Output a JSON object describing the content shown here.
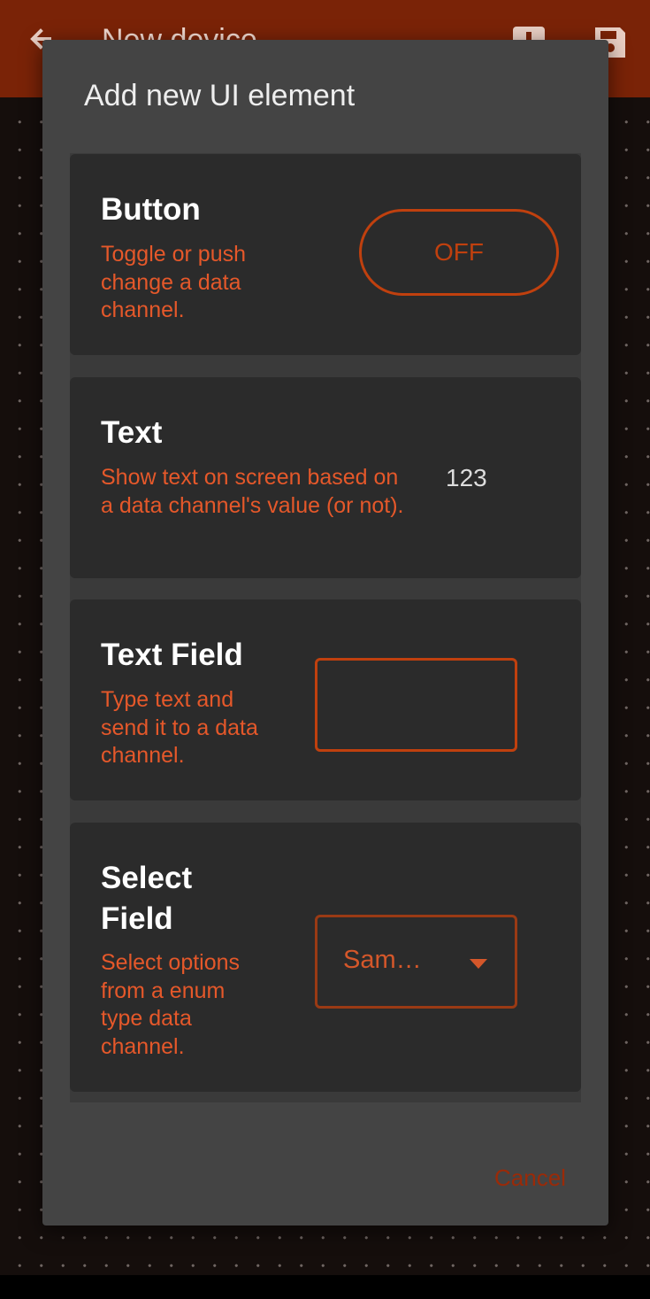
{
  "appbar": {
    "title": "New device",
    "back_icon": "arrow-back-icon",
    "actions": [
      "add-icon",
      "save-icon"
    ]
  },
  "dialog": {
    "title": "Add new UI element",
    "cancel_label": "Cancel",
    "items": [
      {
        "title": "Button",
        "description": "Toggle or push change a data channel.",
        "preview_label": "OFF"
      },
      {
        "title": "Text",
        "description": "Show text on screen based on a data channel's value (or not).",
        "preview_text": "123"
      },
      {
        "title": "Text Field",
        "description": "Type text and send it to a data channel.",
        "preview_value": ""
      },
      {
        "title": "Select Field",
        "description": "Select options from a enum type data channel.",
        "preview_value": "Sam…"
      }
    ]
  },
  "colors": {
    "appbar": "#7a2307",
    "accent": "#e5582a",
    "card": "#2b2b2b",
    "dialog": "#444444"
  }
}
